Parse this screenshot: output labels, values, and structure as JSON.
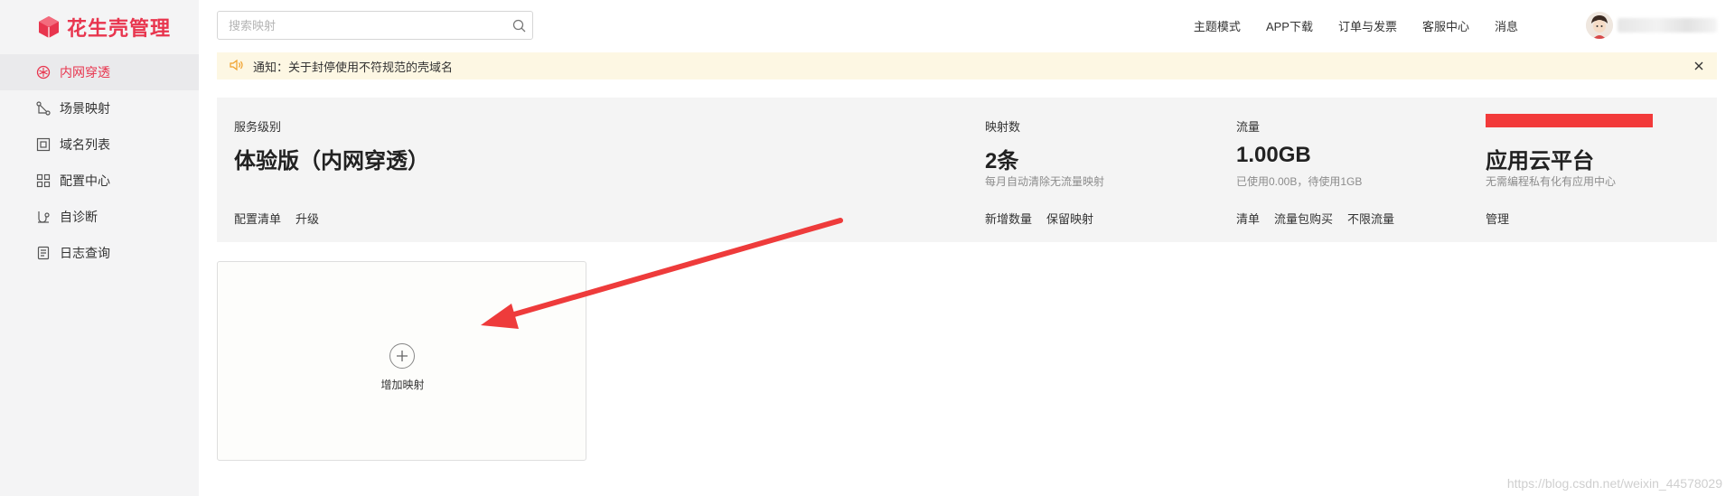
{
  "app": {
    "title": "花生壳管理",
    "brand_color": "#e8354e"
  },
  "sidebar": {
    "items": [
      {
        "label": "内网穿透",
        "icon": "tunnel-icon",
        "active": true
      },
      {
        "label": "场景映射",
        "icon": "scene-icon",
        "active": false
      },
      {
        "label": "域名列表",
        "icon": "domain-icon",
        "active": false
      },
      {
        "label": "配置中心",
        "icon": "config-icon",
        "active": false
      },
      {
        "label": "自诊断",
        "icon": "diagnose-icon",
        "active": false
      },
      {
        "label": "日志查询",
        "icon": "log-icon",
        "active": false
      }
    ]
  },
  "header": {
    "search_placeholder": "搜索映射",
    "nav": [
      "主题模式",
      "APP下载",
      "订单与发票",
      "客服中心",
      "消息"
    ]
  },
  "notice": {
    "text": "通知：关于封停使用不符规范的壳域名"
  },
  "stats": {
    "service": {
      "label": "服务级别",
      "value": "体验版（内网穿透）",
      "actions": [
        "配置清单",
        "升级"
      ]
    },
    "mappings": {
      "label": "映射数",
      "value": "2条",
      "sub": "每月自动清除无流量映射",
      "actions": [
        "新增数量",
        "保留映射"
      ]
    },
    "traffic": {
      "label": "流量",
      "value": "1.00GB",
      "sub": "已使用0.00B，待使用1GB",
      "actions": [
        "清单",
        "流量包购买",
        "不限流量"
      ]
    },
    "cloud": {
      "value": "应用云平台",
      "sub": "无需编程私有化有应用中心",
      "actions": [
        "管理"
      ]
    }
  },
  "add_card": {
    "label": "增加映射"
  },
  "watermark": "https://blog.csdn.net/weixin_44578029",
  "colors": {
    "annotation_arrow": "#ee3b3b",
    "notice_bg": "#fdf7e3",
    "panel_bg": "#f4f4f4"
  }
}
